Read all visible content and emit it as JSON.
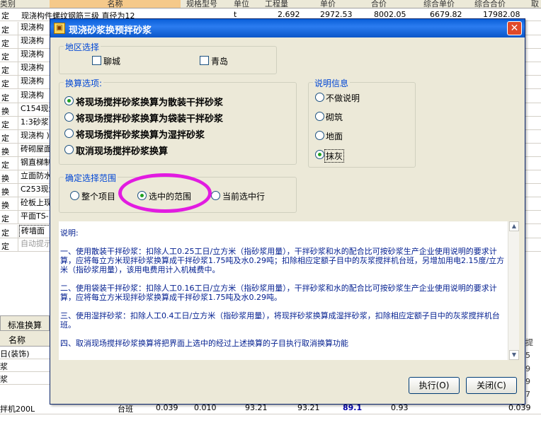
{
  "background": {
    "header_cols": [
      "类别",
      "名称",
      "规格型号",
      "单位",
      "工程量",
      "单价",
      "合价",
      "综合单价",
      "综合合价",
      "取"
    ],
    "first_row": {
      "prefix": "定",
      "name": "现浇构件螺纹钢筋三级 直径为12",
      "unit": "t",
      "qty": "2.692",
      "price": "2972.53",
      "total": "8002.05",
      "unit_total": "6679.82",
      "sum": "17982.08"
    },
    "rows": [
      {
        "type": "定",
        "name": "现浇构"
      },
      {
        "type": "定",
        "name": "现浇构"
      },
      {
        "type": "定",
        "name": "现浇构"
      },
      {
        "type": "定",
        "name": "现浇构"
      },
      {
        "type": "定",
        "name": "现浇构"
      },
      {
        "type": "定",
        "name": "现浇构"
      },
      {
        "type": "换",
        "name": "C154现浇 碎石<40"
      },
      {
        "type": "定",
        "name": "1:3砂浆 找平层"
      },
      {
        "type": "定",
        "name": "现浇构 )"
      },
      {
        "type": "换",
        "name": "砖砌屋面 ]"
      },
      {
        "type": "定",
        "name": "钢直梯制"
      },
      {
        "type": "换",
        "name": "立面防水 室外回填"
      },
      {
        "type": "换",
        "name": "C253现浇 石<31.5"
      },
      {
        "type": "换",
        "name": "砼板上现 珍珠岩保"
      },
      {
        "type": "定",
        "name": "平面TS-"
      },
      {
        "type": "定",
        "name": "砖墙面"
      },
      {
        "type": "定",
        "name": "自动提示"
      }
    ],
    "tab": "标准换算",
    "bottom_header": "名称",
    "bottom_rows": [
      "日(装饰)",
      "浆",
      "浆"
    ],
    "last_row": {
      "name": "拌机200L",
      "unit": "台班",
      "v1": "0.039",
      "v2": "0.010",
      "v3": "93.21",
      "v4": "93.21",
      "v5": "89.1",
      "v6": "0.93",
      "v7": "0.039"
    },
    "right_col": [
      "提",
      "5",
      "9",
      "9",
      "7"
    ]
  },
  "dialog": {
    "title": "现浇砂浆换预拌砂浆",
    "region_group": {
      "title": "地区选择",
      "options": [
        {
          "label": "聊城",
          "checked": false
        },
        {
          "label": "青岛",
          "checked": false
        }
      ]
    },
    "convert_group": {
      "title": "换算选项:",
      "options": [
        {
          "label": "将现场搅拌砂浆换算为散装干拌砂浆",
          "selected": true
        },
        {
          "label": "将现场搅拌砂浆换算为袋装干拌砂浆",
          "selected": false
        },
        {
          "label": "将现场搅拌砂浆换算为湿拌砂浆",
          "selected": false
        },
        {
          "label": "取消现场搅拌砂浆换算",
          "selected": false
        }
      ]
    },
    "info_group": {
      "title": "说明信息",
      "options": [
        {
          "label": "不做说明",
          "selected": false
        },
        {
          "label": "砌筑",
          "selected": false
        },
        {
          "label": "地面",
          "selected": false
        },
        {
          "label": "抹灰",
          "selected": true
        }
      ]
    },
    "scope_group": {
      "title": "确定选择范围",
      "options": [
        {
          "label": "整个项目",
          "selected": false
        },
        {
          "label": "选中的范围",
          "selected": true
        },
        {
          "label": "当前选中行",
          "selected": false
        }
      ]
    },
    "description": {
      "heading": "说明:",
      "paragraphs": [
        "一、使用散装干拌砂浆：扣除人工0.25工日/立方米（指砂浆用量），干拌砂浆和水的配合比可按砂浆生产企业使用说明的要求计算，应将每立方米现拌砂浆换算成干拌砂浆1.75吨及水0.29吨；扣除相应定额子目中的灰浆搅拌机台班，另增加用电2.15度/立方米（指砂浆用量），该用电费用计入机械费中。",
        "二、使用袋装干拌砂浆：扣除人工0.16工日/立方米（指砂浆用量），干拌砂浆和水的配合比可按砂浆生产企业使用说明的要求计算，应将每立方米现拌砂浆换算成干拌砂浆1.75吨及水0.29吨。",
        "三、使用湿拌砂浆：扣除人工0.4工日/立方米（指砂浆用量），将现拌砂浆换算成湿拌砂浆，扣除相应定额子目中的灰浆搅拌机台班。",
        "四、取消现场搅拌砂浆换算将把界面上选中的经过上述换算的子目执行取消换算功能"
      ]
    },
    "buttons": {
      "execute": "执行(O)",
      "close": "关闭(C)"
    }
  }
}
